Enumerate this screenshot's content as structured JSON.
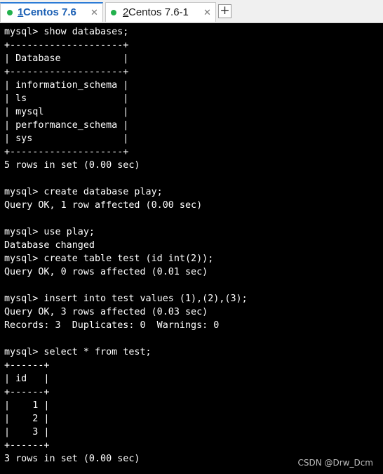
{
  "tabs": [
    {
      "dot_color": "#22b14c",
      "number": "1",
      "title": " Centos 7.6",
      "close": "✕",
      "active": true
    },
    {
      "dot_color": "#22b14c",
      "number": "2",
      "title": " Centos 7.6-1",
      "close": "✕",
      "active": false
    }
  ],
  "new_tab_label": "+",
  "terminal": {
    "text_color": "#ffffff",
    "background": "#000000",
    "lines": [
      "mysql> show databases;",
      "+--------------------+",
      "| Database           |",
      "+--------------------+",
      "| information_schema |",
      "| ls                 |",
      "| mysql              |",
      "| performance_schema |",
      "| sys                |",
      "+--------------------+",
      "5 rows in set (0.00 sec)",
      "",
      "mysql> create database play;",
      "Query OK, 1 row affected (0.00 sec)",
      "",
      "mysql> use play;",
      "Database changed",
      "mysql> create table test (id int(2));",
      "Query OK, 0 rows affected (0.01 sec)",
      "",
      "mysql> insert into test values (1),(2),(3);",
      "Query OK, 3 rows affected (0.03 sec)",
      "Records: 3  Duplicates: 0  Warnings: 0",
      "",
      "mysql> select * from test;",
      "+------+",
      "| id   |",
      "+------+",
      "|    1 |",
      "|    2 |",
      "|    3 |",
      "+------+",
      "3 rows in set (0.00 sec)"
    ]
  },
  "watermark": "CSDN @Drw_Dcm"
}
